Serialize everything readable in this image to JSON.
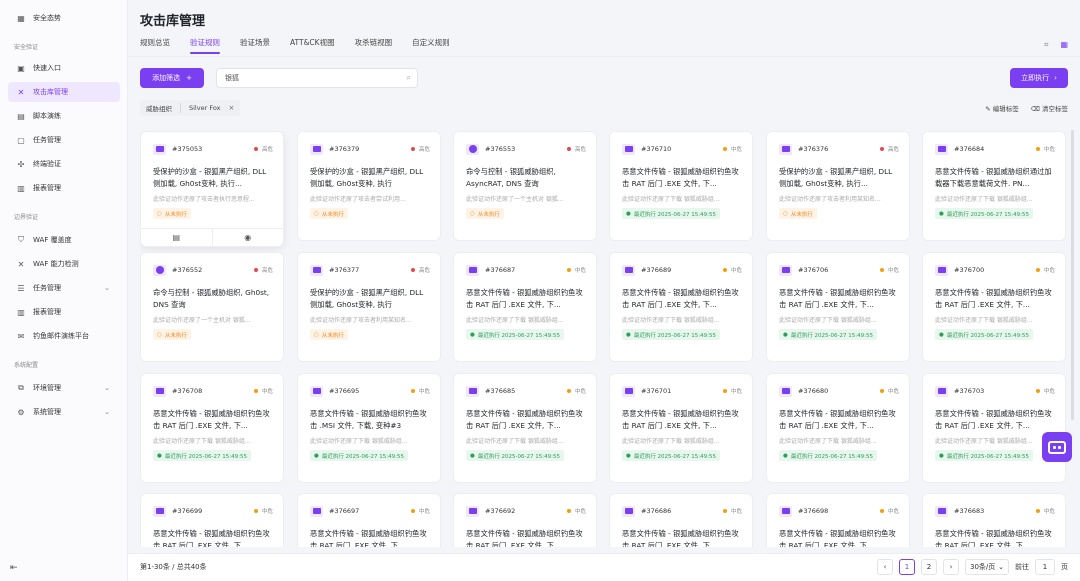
{
  "sidebar": {
    "top_item": "安全态势",
    "sections": {
      "security": "安全验证",
      "boundary": "边界验证",
      "system": "系统配置"
    },
    "items": {
      "quick_entry": "快速入口",
      "attack_lib": "攻击库管理",
      "script_drill": "脚本演练",
      "task_mgmt": "任务管理",
      "endpoint_verify": "终端验证",
      "report_mgmt": "报表管理",
      "waf_coverage": "WAF 覆盖度",
      "waf_detect": "WAF 能力检测",
      "task_mgmt2": "任务管理",
      "report_mgmt2": "报表管理",
      "phishing": "钓鱼邮件演练平台",
      "env_mgmt": "环境管理",
      "sys_mgmt": "系统管理"
    }
  },
  "header": {
    "title": "攻击库管理",
    "tabs": [
      "规则总览",
      "验证规则",
      "验证场景",
      "ATT&CK视图",
      "攻杀链视图",
      "自定义规则"
    ]
  },
  "toolbar": {
    "add_filter": "添加筛选",
    "plus": "+",
    "search_value": "银狐",
    "run_now": "立即执行",
    "run_arrow": "›"
  },
  "filter": {
    "key": "威胁组织",
    "value": "Silver Fox",
    "remove": "×"
  },
  "tag_actions": {
    "edit": "编辑标签",
    "clear": "清空标签"
  },
  "risk": {
    "high": "高危",
    "mid": "中危"
  },
  "status": {
    "never": "从未执行",
    "recent": "最近执行 2025-06-27 15:49:55"
  },
  "cards": [
    {
      "id": "#375053",
      "risk": "high",
      "title": "受保护的沙盒 - 银狐黑产组织, DLL侧加载, Gh0st变种, 执行...",
      "desc": "此验证动作还原了攻击者执行恶意程...",
      "status": "never",
      "icon": "doc"
    },
    {
      "id": "#376379",
      "risk": "high",
      "title": "受保护的沙盒 - 银狐黑产组织, DLL侧加载, Gh0st变种, 执行",
      "desc": "此验证动作还原了攻击者尝试利用...",
      "status": "never",
      "icon": "doc"
    },
    {
      "id": "#376553",
      "risk": "high",
      "title": "命令与控制 - 银狐威胁组织, AsyncRAT, DNS 查询",
      "desc": "此验证动作还原了一个主机对 银狐...",
      "status": "never",
      "icon": "globe"
    },
    {
      "id": "#376710",
      "risk": "mid",
      "title": "恶意文件传输 - 银狐威胁组织钓鱼攻击 RAT 后门 .EXE 文件, 下...",
      "desc": "此验证动作还原了下载 银狐威胁组...",
      "status": "recent",
      "icon": "doc"
    },
    {
      "id": "#376376",
      "risk": "high",
      "title": "受保护的沙盒 - 银狐黑产组织, DLL侧加载, Gh0st变种, 执行...",
      "desc": "此验证动作还原了攻击者利用某知名...",
      "status": "never",
      "icon": "doc"
    },
    {
      "id": "#376684",
      "risk": "mid",
      "title": "恶意文件传输 - 银狐威胁组织通过加载器下载恶意载荷文件. PN...",
      "desc": "此验证动作还原了下载 银狐威胁组...",
      "status": "recent",
      "icon": "doc"
    },
    {
      "id": "#376552",
      "risk": "high",
      "title": "命令与控制 - 银狐威胁组织, Gh0st, DNS 查询",
      "desc": "此验证动作还原了一个主机对 银狐...",
      "status": "never",
      "icon": "globe"
    },
    {
      "id": "#376377",
      "risk": "high",
      "title": "受保护的沙盒 - 银狐黑产组织, DLL侧加载, Gh0st变种, 执行",
      "desc": "此验证动作还原了攻击者利用某知名...",
      "status": "never",
      "icon": "doc"
    },
    {
      "id": "#376687",
      "risk": "mid",
      "title": "恶意文件传输 - 银狐威胁组织钓鱼攻击 RAT 后门 .EXE 文件, 下...",
      "desc": "此验证动作还原了下载 银狐威胁组...",
      "status": "recent",
      "icon": "doc"
    },
    {
      "id": "#376689",
      "risk": "mid",
      "title": "恶意文件传输 - 银狐威胁组织钓鱼攻击 RAT 后门 .EXE 文件, 下...",
      "desc": "此验证动作还原了下载 银狐威胁组...",
      "status": "recent",
      "icon": "doc"
    },
    {
      "id": "#376706",
      "risk": "mid",
      "title": "恶意文件传输 - 银狐威胁组织钓鱼攻击 RAT 后门 .EXE 文件, 下...",
      "desc": "此验证动作还原了下载 银狐威胁组...",
      "status": "recent",
      "icon": "doc"
    },
    {
      "id": "#376700",
      "risk": "mid",
      "title": "恶意文件传输 - 银狐威胁组织钓鱼攻击 RAT 后门 .EXE 文件, 下...",
      "desc": "此验证动作还原了下载 银狐威胁组...",
      "status": "recent",
      "icon": "doc"
    },
    {
      "id": "#376708",
      "risk": "mid",
      "title": "恶意文件传输 - 银狐威胁组织钓鱼攻击 RAT 后门 .EXE 文件, 下...",
      "desc": "此验证动作还原了下载 银狐威胁组...",
      "status": "recent",
      "icon": "doc"
    },
    {
      "id": "#376695",
      "risk": "mid",
      "title": "恶意文件传输 - 银狐威胁组织钓鱼攻击 .MSI 文件, 下载, 变种#3",
      "desc": "此验证动作还原了下载 银狐威胁组...",
      "status": "recent",
      "icon": "doc"
    },
    {
      "id": "#376685",
      "risk": "mid",
      "title": "恶意文件传输 - 银狐威胁组织钓鱼攻击 RAT 后门 .EXE 文件, 下...",
      "desc": "此验证动作还原了下载 银狐威胁组...",
      "status": "recent",
      "icon": "doc"
    },
    {
      "id": "#376701",
      "risk": "mid",
      "title": "恶意文件传输 - 银狐威胁组织钓鱼攻击 RAT 后门 .EXE 文件, 下...",
      "desc": "此验证动作还原了下载 银狐威胁组...",
      "status": "recent",
      "icon": "doc"
    },
    {
      "id": "#376680",
      "risk": "mid",
      "title": "恶意文件传输 - 银狐威胁组织钓鱼攻击 RAT 后门 .EXE 文件, 下...",
      "desc": "此验证动作还原了下载 银狐威胁组...",
      "status": "recent",
      "icon": "doc"
    },
    {
      "id": "#376703",
      "risk": "mid",
      "title": "恶意文件传输 - 银狐威胁组织钓鱼攻击 RAT 后门 .EXE 文件, 下...",
      "desc": "此验证动作还原了下载 银狐威胁组...",
      "status": "recent",
      "icon": "doc"
    },
    {
      "id": "#376699",
      "risk": "mid",
      "title": "恶意文件传输 - 银狐威胁组织钓鱼攻击 RAT 后门 .EXE 文件, 下...",
      "desc": "",
      "status": "",
      "icon": "doc"
    },
    {
      "id": "#376697",
      "risk": "mid",
      "title": "恶意文件传输 - 银狐威胁组织钓鱼攻击 RAT 后门 .EXE 文件, 下...",
      "desc": "",
      "status": "",
      "icon": "doc"
    },
    {
      "id": "#376692",
      "risk": "mid",
      "title": "恶意文件传输 - 银狐威胁组织钓鱼攻击 RAT 后门 .EXE 文件, 下...",
      "desc": "",
      "status": "",
      "icon": "doc"
    },
    {
      "id": "#376686",
      "risk": "mid",
      "title": "恶意文件传输 - 银狐威胁组织钓鱼攻击 RAT 后门 .EXE 文件, 下...",
      "desc": "",
      "status": "",
      "icon": "doc"
    },
    {
      "id": "#376698",
      "risk": "mid",
      "title": "恶意文件传输 - 银狐威胁组织钓鱼攻击 RAT 后门 .EXE 文件, 下...",
      "desc": "",
      "status": "",
      "icon": "doc"
    },
    {
      "id": "#376683",
      "risk": "mid",
      "title": "恶意文件传输 - 银狐威胁组织钓鱼攻击 RAT 后门 .EXE 文件, 下...",
      "desc": "",
      "status": "",
      "icon": "doc"
    }
  ],
  "footer": {
    "total": "第1-30条 / 总共40条",
    "pages": [
      "1",
      "2"
    ],
    "page_size": "30条/页",
    "goto_label": "前往",
    "goto_value": "1",
    "unit": "页"
  },
  "colors": {
    "accent": "#7b3ff2",
    "high": "#e5484d",
    "mid": "#f59e0b",
    "recent": "#2f9e59",
    "never": "#f08a24"
  }
}
